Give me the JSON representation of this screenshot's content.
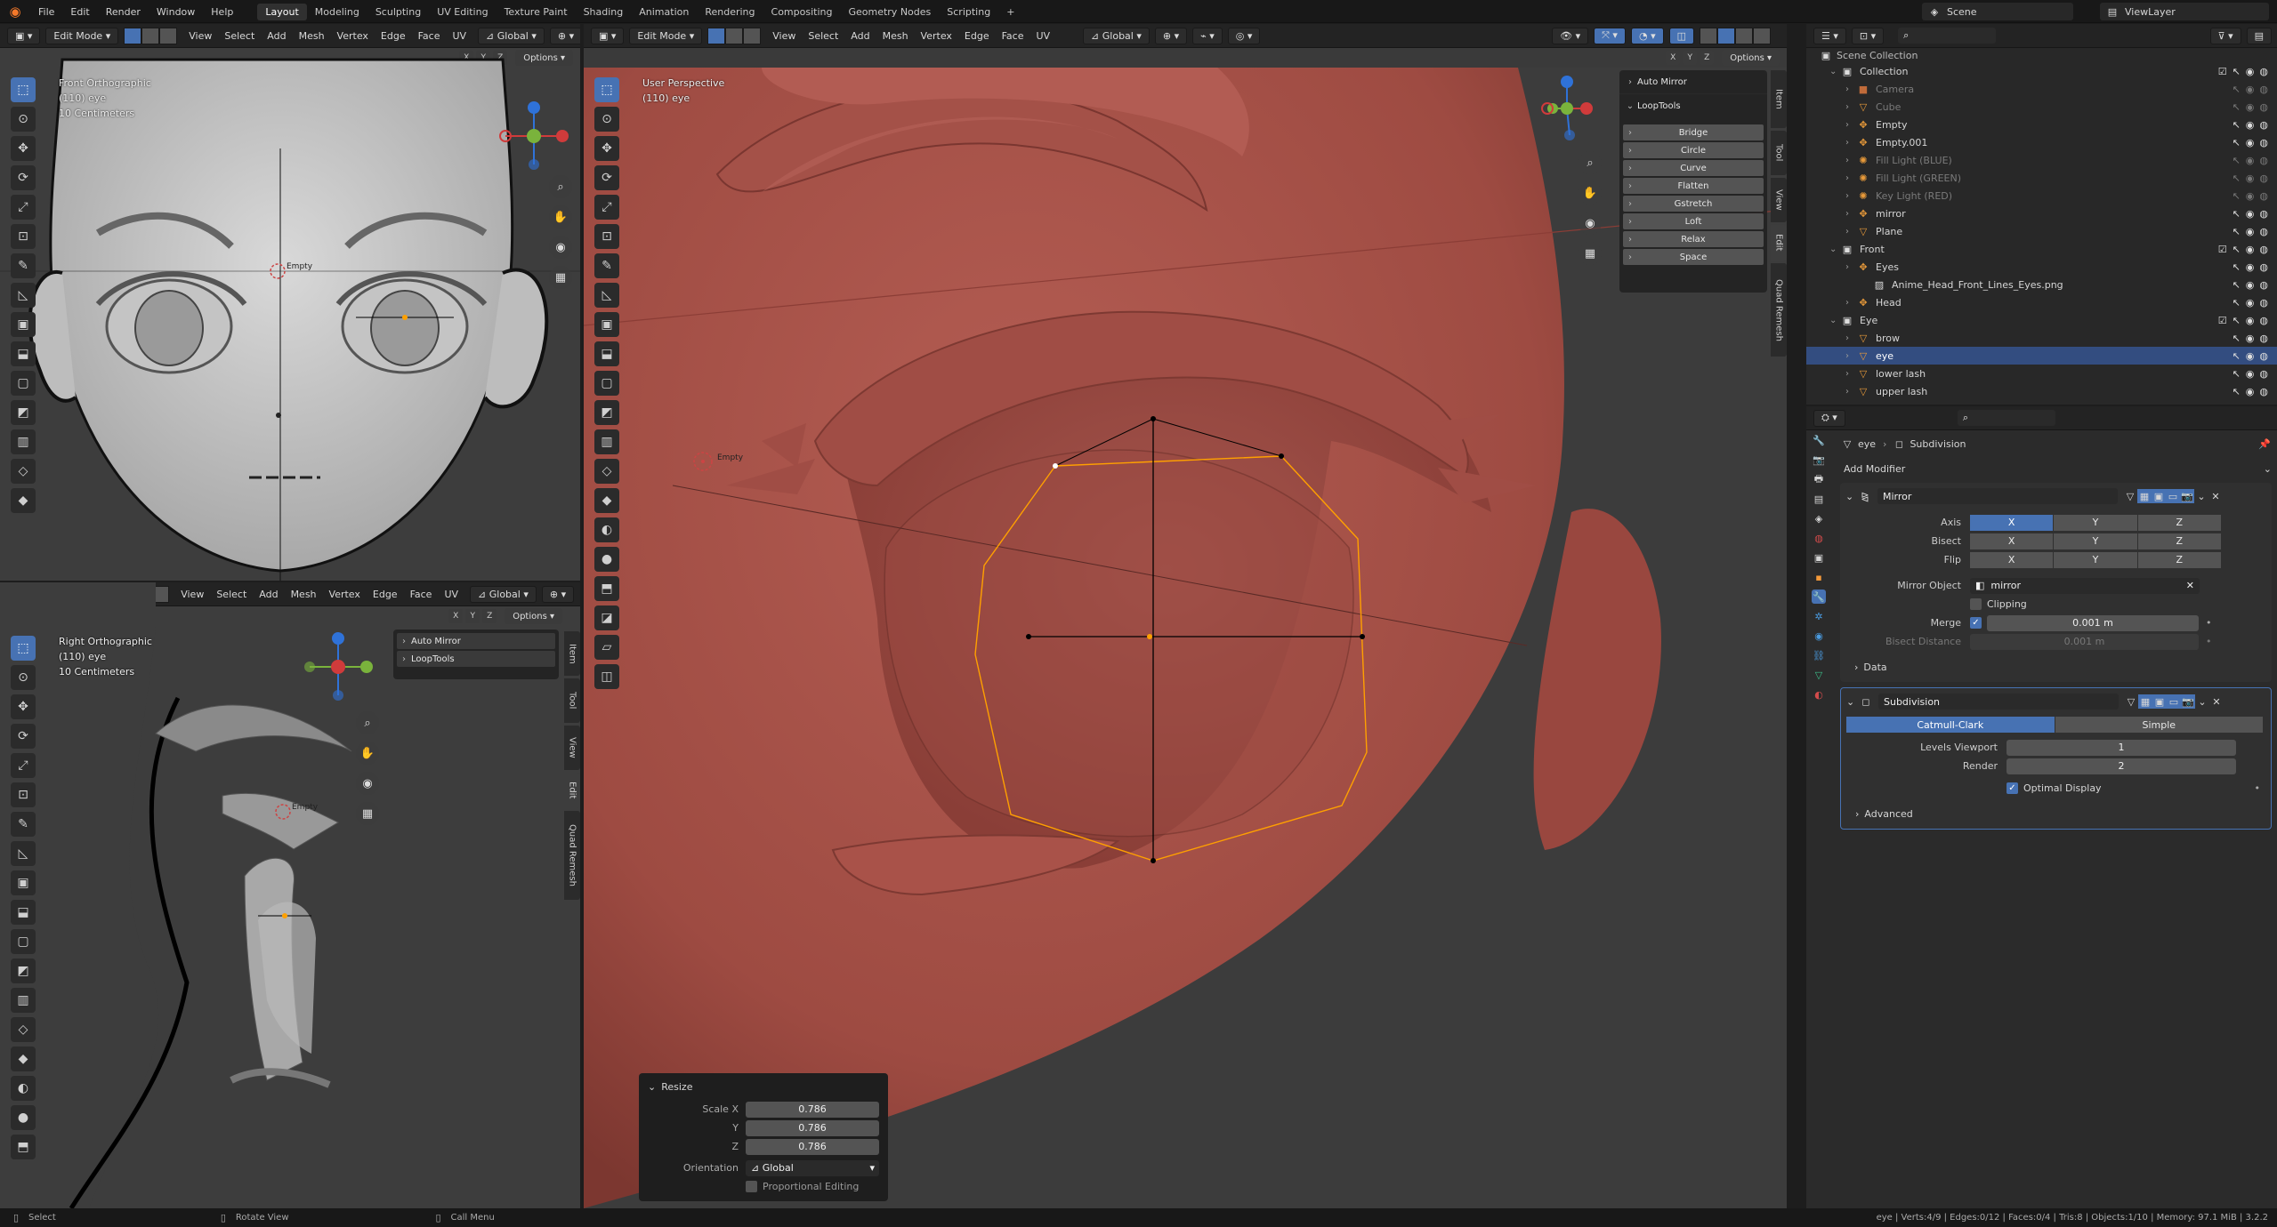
{
  "topbar": {
    "menus": [
      "File",
      "Edit",
      "Render",
      "Window",
      "Help"
    ],
    "workspaces": [
      "Layout",
      "Modeling",
      "Sculpting",
      "UV Editing",
      "Texture Paint",
      "Shading",
      "Animation",
      "Rendering",
      "Compositing",
      "Geometry Nodes",
      "Scripting"
    ],
    "active_workspace": "Layout",
    "add_tab": "+",
    "scene": "Scene",
    "view_layer": "ViewLayer"
  },
  "viewport_header": {
    "mode": "Edit Mode",
    "menus": [
      "View",
      "Select",
      "Add",
      "Mesh",
      "Vertex",
      "Edge",
      "Face",
      "UV"
    ],
    "orientation": "Global",
    "axes": [
      "X",
      "Y",
      "Z"
    ],
    "options": "Options"
  },
  "vp_front": {
    "view_name": "Front Orthographic",
    "object": "(110) eye",
    "scale": "10 Centimeters",
    "empty_label": "Empty"
  },
  "vp_right": {
    "view_name": "Right Orthographic",
    "object": "(110) eye",
    "scale": "10 Centimeters",
    "empty_label": "Empty",
    "panels": [
      "Auto Mirror",
      "LoopTools"
    ]
  },
  "vp_main": {
    "view_name": "User Perspective",
    "object": "(110) eye",
    "empty_label": "Empty",
    "auto_mirror": "Auto Mirror",
    "looptools": {
      "title": "LoopTools",
      "items": [
        "Bridge",
        "Circle",
        "Curve",
        "Flatten",
        "Gstretch",
        "Loft",
        "Relax",
        "Space"
      ]
    }
  },
  "n_tabs": [
    "Item",
    "Tool",
    "View",
    "Edit",
    "Quad Remesh"
  ],
  "redo_panel": {
    "title": "Resize",
    "scale_x_label": "Scale X",
    "y_label": "Y",
    "z_label": "Z",
    "scale_x": "0.786",
    "scale_y": "0.786",
    "scale_z": "0.786",
    "orientation_label": "Orientation",
    "orientation": "Global",
    "proportional": "Proportional Editing"
  },
  "outliner": {
    "root": "Scene Collection",
    "rows": [
      {
        "name": "Collection",
        "level": 1,
        "type": "collection",
        "dim": false,
        "sel": false
      },
      {
        "name": "Camera",
        "level": 2,
        "type": "camera",
        "dim": true,
        "sel": false
      },
      {
        "name": "Cube",
        "level": 2,
        "type": "mesh",
        "dim": true,
        "sel": false
      },
      {
        "name": "Empty",
        "level": 2,
        "type": "empty",
        "dim": false,
        "sel": false
      },
      {
        "name": "Empty.001",
        "level": 2,
        "type": "empty",
        "dim": false,
        "sel": false
      },
      {
        "name": "Fill Light (BLUE)",
        "level": 2,
        "type": "light",
        "dim": true,
        "sel": false
      },
      {
        "name": "Fill Light (GREEN)",
        "level": 2,
        "type": "light",
        "dim": true,
        "sel": false
      },
      {
        "name": "Key Light (RED)",
        "level": 2,
        "type": "light",
        "dim": true,
        "sel": false
      },
      {
        "name": "mirror",
        "level": 2,
        "type": "empty",
        "dim": false,
        "sel": false
      },
      {
        "name": "Plane",
        "level": 2,
        "type": "mesh",
        "dim": false,
        "sel": false
      },
      {
        "name": "Front",
        "level": 1,
        "type": "collection",
        "dim": false,
        "sel": false
      },
      {
        "name": "Eyes",
        "level": 2,
        "type": "empty",
        "dim": false,
        "sel": false
      },
      {
        "name": "Anime_Head_Front_Lines_Eyes.png",
        "level": 3,
        "type": "image",
        "dim": false,
        "sel": false
      },
      {
        "name": "Head",
        "level": 2,
        "type": "empty",
        "dim": false,
        "sel": false
      },
      {
        "name": "Eye",
        "level": 1,
        "type": "collection",
        "dim": false,
        "sel": false
      },
      {
        "name": "brow",
        "level": 2,
        "type": "mesh",
        "dim": false,
        "sel": false
      },
      {
        "name": "eye",
        "level": 2,
        "type": "mesh",
        "dim": false,
        "sel": true
      },
      {
        "name": "lower lash",
        "level": 2,
        "type": "mesh",
        "dim": false,
        "sel": false
      },
      {
        "name": "upper lash",
        "level": 2,
        "type": "mesh",
        "dim": false,
        "sel": false
      }
    ]
  },
  "properties": {
    "breadcrumb_object": "eye",
    "breadcrumb_modifier": "Subdivision",
    "add_modifier": "Add Modifier",
    "mirror": {
      "name": "Mirror",
      "axis_label": "Axis",
      "bisect_label": "Bisect",
      "flip_label": "Flip",
      "axes": [
        "X",
        "Y",
        "Z"
      ],
      "mirror_object_label": "Mirror Object",
      "mirror_object": "mirror",
      "clipping": "Clipping",
      "merge_label": "Merge",
      "merge": "0.001 m",
      "bisect_distance_label": "Bisect Distance",
      "bisect_distance": "0.001 m",
      "data": "Data"
    },
    "subdivision": {
      "name": "Subdivision",
      "catmull": "Catmull-Clark",
      "simple": "Simple",
      "levels_label": "Levels Viewport",
      "levels": "1",
      "render_label": "Render",
      "render": "2",
      "optimal": "Optimal Display",
      "advanced": "Advanced"
    }
  },
  "statusbar": {
    "select": "Select",
    "rotate": "Rotate View",
    "menu": "Call Menu",
    "stats": "eye | Verts:4/9 | Edges:0/12 | Faces:0/4 | Tris:8 | Objects:1/10 | Memory: 97.1 MiB | 3.2.2"
  },
  "colors": {
    "accent": "#4772b3",
    "selected_row": "#334d80",
    "skin": "#a5544b",
    "edge_select": "#ffa000"
  }
}
